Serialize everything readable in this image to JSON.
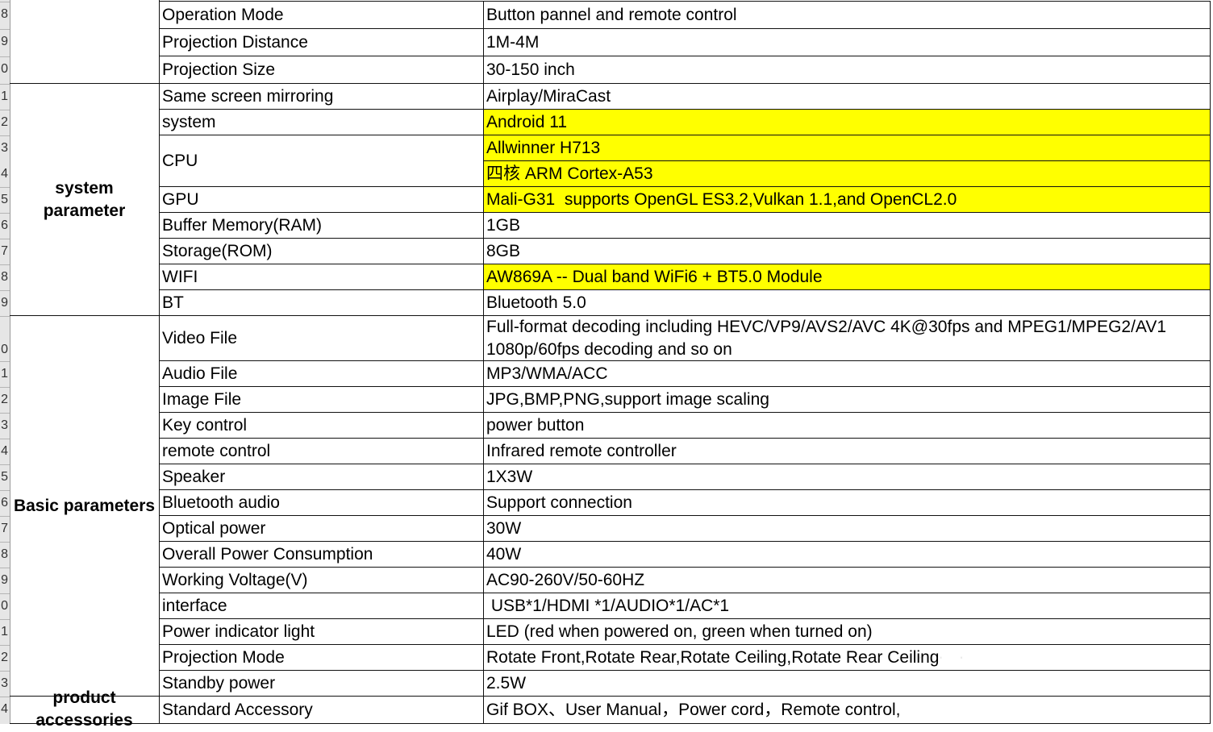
{
  "row_numbers": [
    "8",
    "9",
    "0",
    "1",
    "2",
    "3",
    "4",
    "5",
    "6",
    "7",
    "8",
    "9",
    "0",
    "1",
    "2",
    "3",
    "4",
    "5",
    "6",
    "7",
    "8",
    "9",
    "0",
    "1",
    "2",
    "3",
    "4"
  ],
  "groups": [
    {
      "lines": [
        "system",
        "parameter"
      ]
    },
    {
      "lines": [
        "Basic parameters"
      ]
    },
    {
      "lines": [
        "product",
        "accessories"
      ]
    }
  ],
  "rows": [
    {
      "param": "Operation Mode",
      "value": "Button pannel and remote control"
    },
    {
      "param": "Projection Distance",
      "value": "1M-4M"
    },
    {
      "param": "Projection Size",
      "value": "30-150 inch"
    },
    {
      "param": "Same screen mirroring",
      "value": "Airplay/MiraCast"
    },
    {
      "param": "system",
      "value": "Android 11",
      "highlight": true
    },
    {
      "param": "CPU",
      "value": "Allwinner H713",
      "value2": "四核 ARM Cortex-A53",
      "highlight": true
    },
    {
      "param": "GPU",
      "value": "Mali-G31  supports OpenGL ES3.2,Vulkan 1.1,and OpenCL2.0",
      "highlight": true
    },
    {
      "param": "Buffer Memory(RAM)",
      "value": "1GB"
    },
    {
      "param": "Storage(ROM)",
      "value": "8GB"
    },
    {
      "param": "WIFI",
      "value": "AW869A -- Dual band WiFi6 + BT5.0 Module",
      "highlight": true
    },
    {
      "param": "BT",
      "value": "Bluetooth 5.0"
    },
    {
      "param": "Video File",
      "value": "Full-format decoding including HEVC/VP9/AVS2/AVC 4K@30fps and MPEG1/MPEG2/AV1 1080p/60fps decoding and so on"
    },
    {
      "param": "Audio File",
      "value": "MP3/WMA/ACC"
    },
    {
      "param": "Image File",
      "value": "JPG,BMP,PNG,support image scaling"
    },
    {
      "param": "Key control",
      "value": "power button"
    },
    {
      "param": "remote control",
      "value": "Infrared remote controller"
    },
    {
      "param": "Speaker",
      "value": "1X3W"
    },
    {
      "param": "Bluetooth audio",
      "value": "Support connection"
    },
    {
      "param": "Optical power",
      "value": "30W"
    },
    {
      "param": "Overall Power Consumption",
      "value": "40W"
    },
    {
      "param": "Working Voltage(V)",
      "value": "AC90-260V/50-60HZ"
    },
    {
      "param": "interface",
      "value": " USB*1/HDMI *1/AUDIO*1/AC*1"
    },
    {
      "param": "Power indicator light",
      "value": "LED (red when powered on, green when turned on)"
    },
    {
      "param": "Projection Mode",
      "value": "Rotate Front,Rotate Rear,Rotate Ceiling,Rotate Rear Ceiling"
    },
    {
      "param": "Standby power",
      "value": "2.5W"
    },
    {
      "param": "Standard Accessory",
      "value": "Gif BOX、User Manual，Power cord，Remote control,"
    }
  ]
}
